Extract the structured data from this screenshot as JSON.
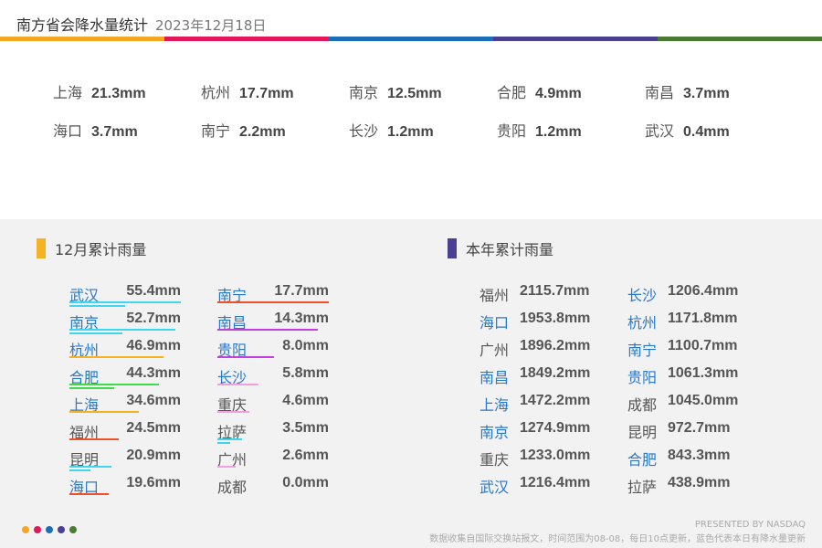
{
  "header": {
    "title": "南方省会降水量统计",
    "date": "2023年12月18日"
  },
  "colors": {
    "band": [
      "#f5a623",
      "#e0185a",
      "#1a6fb5",
      "#4b3f91",
      "#4a7a35"
    ],
    "city_blue": "#2878c8",
    "city_gray": "#555555"
  },
  "today": [
    {
      "city": "上海",
      "value": "21.3mm"
    },
    {
      "city": "杭州",
      "value": "17.7mm"
    },
    {
      "city": "南京",
      "value": "12.5mm"
    },
    {
      "city": "合肥",
      "value": "4.9mm"
    },
    {
      "city": "南昌",
      "value": "3.7mm"
    },
    {
      "city": "海口",
      "value": "3.7mm"
    },
    {
      "city": "南宁",
      "value": "2.2mm"
    },
    {
      "city": "长沙",
      "value": "1.2mm"
    },
    {
      "city": "贵阳",
      "value": "1.2mm"
    },
    {
      "city": "武汉",
      "value": "0.4mm"
    }
  ],
  "monthly": {
    "title": "12月累计雨量",
    "mark_color": "#f5b324",
    "columns": [
      [
        {
          "city": "武汉",
          "value": "55.4mm",
          "blue": true,
          "bars": [
            "#3fd6f0",
            "#3fd6f0"
          ]
        },
        {
          "city": "南京",
          "value": "52.7mm",
          "blue": true,
          "bars": [
            "#3fd6f0",
            "#3fd6f0"
          ]
        },
        {
          "city": "杭州",
          "value": "46.9mm",
          "blue": true,
          "bars": [
            "#f5b324"
          ]
        },
        {
          "city": "合肥",
          "value": "44.3mm",
          "blue": true,
          "bars": [
            "#3fdc4a",
            "#3fdc4a"
          ]
        },
        {
          "city": "上海",
          "value": "34.6mm",
          "blue": true,
          "bars": [
            "#f5b324"
          ]
        },
        {
          "city": "福州",
          "value": "24.5mm",
          "blue": false,
          "bars": [
            "#f0502a"
          ]
        },
        {
          "city": "昆明",
          "value": "20.9mm",
          "blue": false,
          "bars": [
            "#3fd6f0",
            "#3fd6f0"
          ]
        },
        {
          "city": "海口",
          "value": "19.6mm",
          "blue": true,
          "bars": [
            "#f0502a"
          ]
        }
      ],
      [
        {
          "city": "南宁",
          "value": "17.7mm",
          "blue": true,
          "bars": [
            "#f0502a"
          ]
        },
        {
          "city": "南昌",
          "value": "14.3mm",
          "blue": true,
          "bars": [
            "#c040e0"
          ]
        },
        {
          "city": "贵阳",
          "value": "8.0mm",
          "blue": true,
          "bars": [
            "#c040e0"
          ]
        },
        {
          "city": "长沙",
          "value": "5.8mm",
          "blue": true,
          "bars": [
            "#f0a0e0"
          ]
        },
        {
          "city": "重庆",
          "value": "4.6mm",
          "blue": false,
          "bars": [
            "#f0a0e0"
          ]
        },
        {
          "city": "拉萨",
          "value": "3.5mm",
          "blue": false,
          "bars": [
            "#3fd6f0",
            "#3fd6f0"
          ]
        },
        {
          "city": "广州",
          "value": "2.6mm",
          "blue": false,
          "bars": [
            "#f0a0e0"
          ]
        },
        {
          "city": "成都",
          "value": "0.0mm",
          "blue": false,
          "bars": []
        }
      ]
    ]
  },
  "yearly": {
    "title": "本年累计雨量",
    "mark_color": "#4b3f91",
    "columns": [
      [
        {
          "city": "福州",
          "value": "2115.7mm",
          "blue": false
        },
        {
          "city": "海口",
          "value": "1953.8mm",
          "blue": true
        },
        {
          "city": "广州",
          "value": "1896.2mm",
          "blue": false
        },
        {
          "city": "南昌",
          "value": "1849.2mm",
          "blue": true
        },
        {
          "city": "上海",
          "value": "1472.2mm",
          "blue": true
        },
        {
          "city": "南京",
          "value": "1274.9mm",
          "blue": true
        },
        {
          "city": "重庆",
          "value": "1233.0mm",
          "blue": false
        },
        {
          "city": "武汉",
          "value": "1216.4mm",
          "blue": true
        }
      ],
      [
        {
          "city": "长沙",
          "value": "1206.4mm",
          "blue": true
        },
        {
          "city": "杭州",
          "value": "1171.8mm",
          "blue": true
        },
        {
          "city": "南宁",
          "value": "1100.7mm",
          "blue": true
        },
        {
          "city": "贵阳",
          "value": "1061.3mm",
          "blue": true
        },
        {
          "city": "成都",
          "value": "1045.0mm",
          "blue": false
        },
        {
          "city": "昆明",
          "value": "972.7mm",
          "blue": false
        },
        {
          "city": "合肥",
          "value": "843.3mm",
          "blue": true
        },
        {
          "city": "拉萨",
          "value": "438.9mm",
          "blue": false
        }
      ]
    ]
  },
  "footer": {
    "credit": "PRESENTED BY NASDAQ",
    "note": "数据收集自国际交换站报文，时间范围为08-08，每日10点更新，蓝色代表本日有降水量更新",
    "dot_colors": [
      "#f5a623",
      "#e0185a",
      "#1a6fb5",
      "#4b3f91",
      "#4a7a35"
    ]
  }
}
